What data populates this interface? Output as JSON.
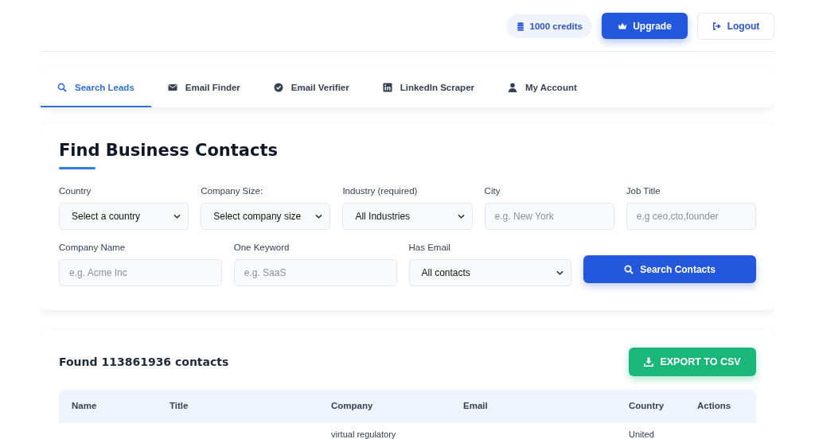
{
  "header": {
    "credits": "1000 credits",
    "upgrade": "Upgrade",
    "logout": "Logout"
  },
  "tabs": [
    {
      "label": "Search Leads",
      "selected": true
    },
    {
      "label": "Email Finder",
      "selected": false
    },
    {
      "label": "Email Verifier",
      "selected": false
    },
    {
      "label": "LinkedIn Scraper",
      "selected": false
    },
    {
      "label": "My Account",
      "selected": false
    }
  ],
  "form": {
    "title": "Find Business Contacts",
    "fields": [
      {
        "label": "Country",
        "kind": "select",
        "value": "Select a country"
      },
      {
        "label": "Company Size:",
        "kind": "select",
        "value": "Select company size"
      },
      {
        "label": "Industry (required)",
        "kind": "select",
        "value": "All Industries"
      },
      {
        "label": "City",
        "kind": "text",
        "placeholder": "e.g. New York"
      },
      {
        "label": "Job Title",
        "kind": "text",
        "placeholder": "e.g ceo,cto,founder"
      }
    ],
    "fields_row_2": [
      {
        "label": "Company Name",
        "kind": "text",
        "placeholder": "e.g. Acme Inc"
      },
      {
        "label": "One Keyword",
        "kind": "text",
        "placeholder": "e.g. SaaS"
      },
      {
        "label": "Has Email",
        "kind": "select",
        "value": "All contacts"
      }
    ],
    "search_button": "Search Contacts"
  },
  "results": {
    "summary": "Found 113861936 contacts",
    "export_button": "EXPORT TO CSV",
    "table": {
      "columns": [
        "Name",
        "Title",
        "Company",
        "Email",
        "Country",
        "Actions"
      ],
      "rows": [
        {
          "company": "virtual regulatory",
          "country": "United"
        }
      ]
    }
  }
}
